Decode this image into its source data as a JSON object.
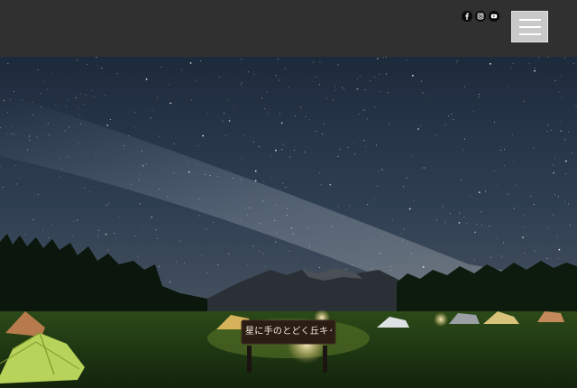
{
  "header": {
    "social": [
      {
        "name": "facebook-icon",
        "glyph": "f"
      },
      {
        "name": "instagram-icon",
        "glyph": "◎"
      },
      {
        "name": "youtube-icon",
        "glyph": "▶"
      }
    ],
    "menu_icon": "hamburger-menu-icon"
  },
  "hero": {
    "sign_text": "星に手のとどく丘キャンプ場",
    "colors": {
      "sky_top": "#26354a",
      "sky_bottom": "#4a5560",
      "header_bg": "#303030",
      "tent_green": "#b8d35a",
      "grass": "#1f3a12"
    }
  }
}
